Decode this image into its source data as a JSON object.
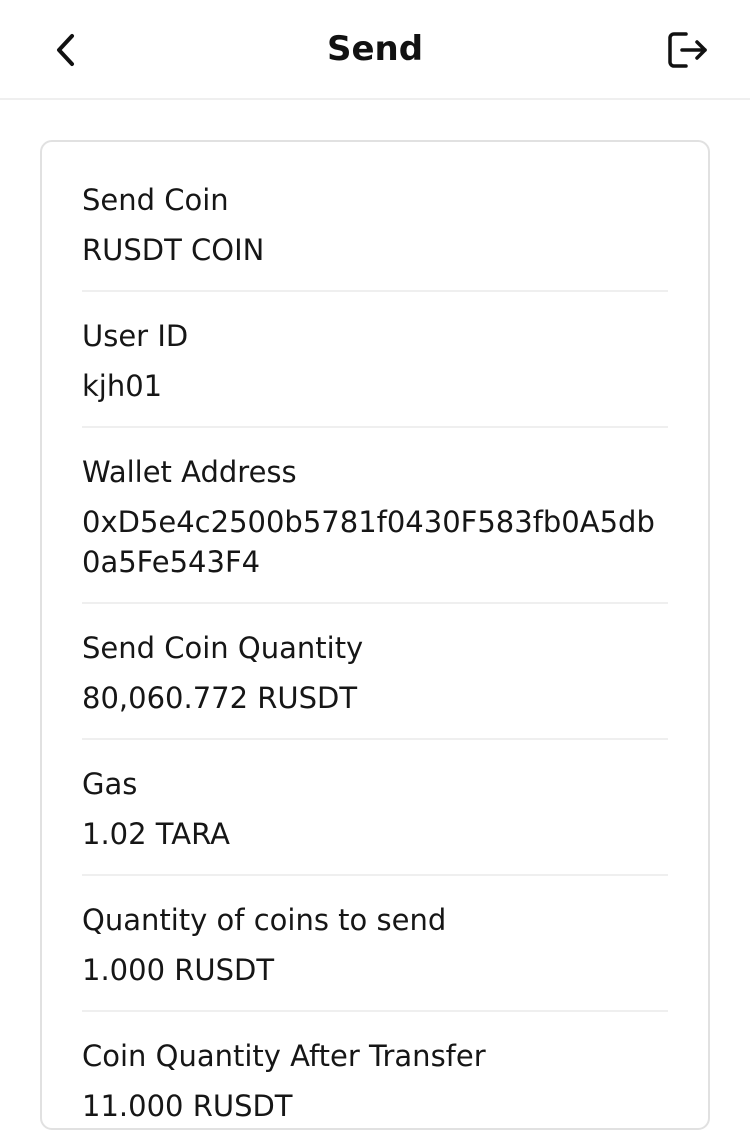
{
  "header": {
    "title": "Send",
    "back_icon": "chevron-left-icon",
    "logout_icon": "logout-icon"
  },
  "details": {
    "send_coin": {
      "label": "Send Coin",
      "value": "RUSDT COIN"
    },
    "user_id": {
      "label": "User ID",
      "value": "kjh01"
    },
    "wallet_address": {
      "label": "Wallet Address",
      "value": "0xD5e4c2500b5781f0430F583fb0A5db0a5Fe543F4"
    },
    "send_coin_quantity": {
      "label": "Send Coin Quantity",
      "value": "80,060.772 RUSDT"
    },
    "gas": {
      "label": "Gas",
      "value": "1.02 TARA"
    },
    "quantity_to_send": {
      "label": "Quantity of coins to send",
      "value": "1.000 RUSDT"
    },
    "quantity_after_transfer": {
      "label": "Coin Quantity After Transfer",
      "value": "11.000 RUSDT"
    }
  }
}
